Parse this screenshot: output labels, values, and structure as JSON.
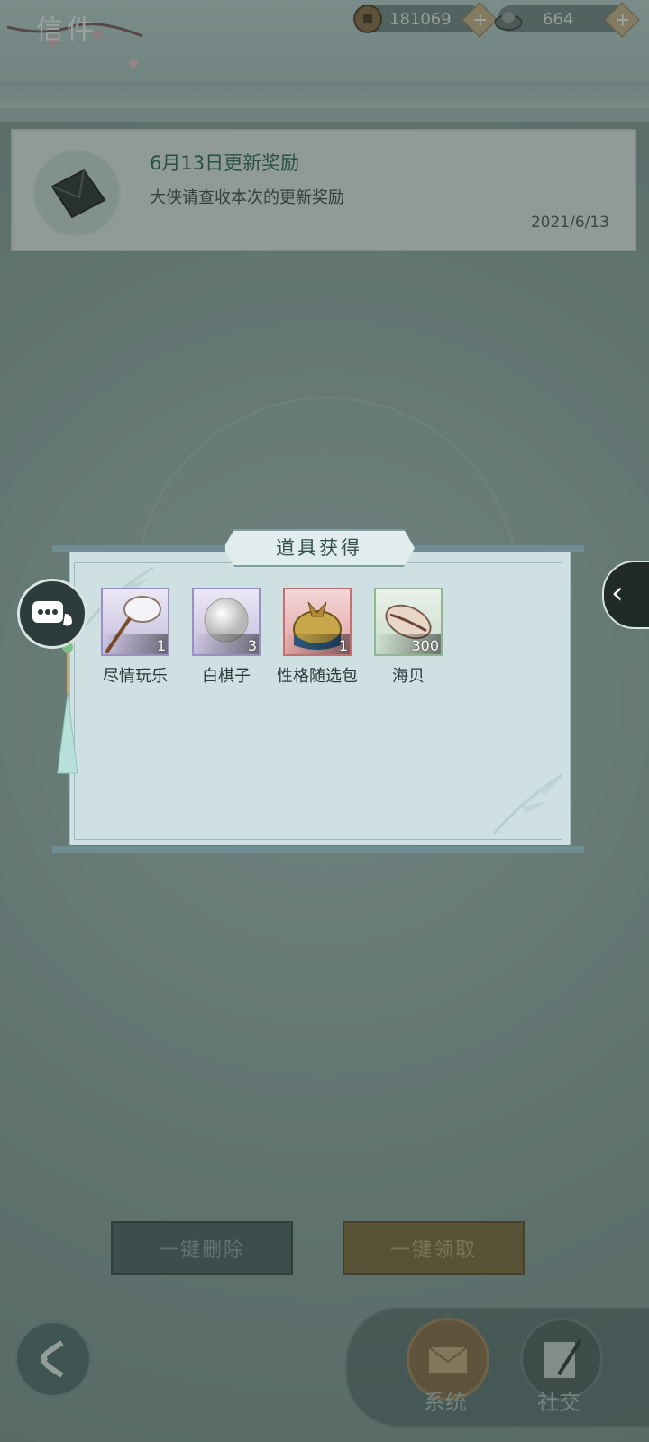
{
  "header": {
    "title": "信件",
    "copper_amount": "181069",
    "silver_amount": "664",
    "add_symbol": "+"
  },
  "mail": {
    "title": "6月13日更新奖励",
    "description": "大侠请查收本次的更新奖励",
    "date": "2021/6/13"
  },
  "popup": {
    "title": "道具获得",
    "items": [
      {
        "name": "尽情玩乐",
        "count": "1",
        "icon": "butterfly-net-icon"
      },
      {
        "name": "白棋子",
        "count": "3",
        "icon": "white-go-stone-icon"
      },
      {
        "name": "性格随选包",
        "count": "1",
        "icon": "cloth-bundle-icon"
      },
      {
        "name": "海贝",
        "count": "300",
        "icon": "seashell-icon"
      }
    ]
  },
  "actions": {
    "delete_all": "一键删除",
    "claim_all": "一键领取"
  },
  "tabs": {
    "system": "系统",
    "social": "社交"
  },
  "colors": {
    "accent_green": "#2f6a4e",
    "claim_gold": "#7f6c3f",
    "delete_slate": "#4d6563"
  }
}
